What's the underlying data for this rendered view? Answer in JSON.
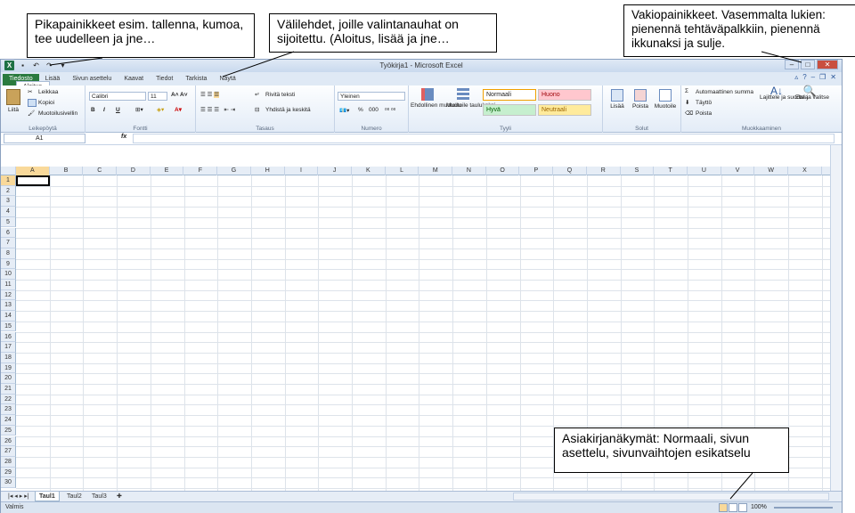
{
  "callouts": {
    "qat": "Pikapainikkeet esim. tallenna, kumoa, tee uudelleen ja jne…",
    "tabs": "Välilehdet, joille valintanauhat on sijoitettu. (Aloitus, lisää ja jne…",
    "window_buttons": "Vakiopainikkeet. Vasemmalta lukien: pienennä tehtäväpalkkiin, pienennä ikkunaksi ja sulje.",
    "views": "Asiakirjanäkymät: Normaali, sivun asettelu, sivunvaihtojen esikatselu"
  },
  "window": {
    "title": "Työkirja1 - Microsoft Excel"
  },
  "tabs": [
    "Tiedosto",
    "Aloitus",
    "Lisää",
    "Sivun asettelu",
    "Kaavat",
    "Tiedot",
    "Tarkista",
    "Näytä"
  ],
  "ribbon": {
    "clipboard": {
      "paste": "Liitä",
      "cut": "Leikkaa",
      "copy": "Kopioi",
      "format_painter": "Muotoilusivellin",
      "label": "Leikepöytä"
    },
    "font": {
      "name": "Calibri",
      "size": "11",
      "bold": "B",
      "italic": "I",
      "underline": "U",
      "label": "Fontti"
    },
    "alignment": {
      "wrap": "Rivitä teksti",
      "merge": "Yhdistä ja keskitä",
      "label": "Tasaus"
    },
    "number": {
      "format": "Yleinen",
      "percent": "%",
      "thousands": "000",
      "label": "Numero"
    },
    "styles": {
      "conditional": "Ehdollinen muotoilu",
      "table": "Muotoile taulukoksi",
      "normal": "Normaali",
      "bad": "Huono",
      "good": "Hyvä",
      "neutral": "Neutraali",
      "label": "Tyyli"
    },
    "cells": {
      "insert": "Lisää",
      "delete": "Poista",
      "format": "Muotoile",
      "label": "Solut"
    },
    "editing": {
      "autosum": "Automaattinen summa",
      "fill": "Täyttö",
      "clear": "Poista",
      "sort": "Lajittele ja suodata",
      "find": "Etsi ja valitse",
      "label": "Muokkaaminen"
    }
  },
  "formula_bar": {
    "name_box": "A1",
    "fx": "fx"
  },
  "columns": [
    "A",
    "B",
    "C",
    "D",
    "E",
    "F",
    "G",
    "H",
    "I",
    "J",
    "K",
    "L",
    "M",
    "N",
    "O",
    "P",
    "Q",
    "R",
    "S",
    "T",
    "U",
    "V",
    "W",
    "X"
  ],
  "rows": [
    "1",
    "2",
    "3",
    "4",
    "5",
    "6",
    "7",
    "8",
    "9",
    "10",
    "11",
    "12",
    "13",
    "14",
    "15",
    "16",
    "17",
    "18",
    "19",
    "20",
    "21",
    "22",
    "23",
    "24",
    "25",
    "26",
    "27",
    "28",
    "29",
    "30"
  ],
  "sheets": [
    "Taul1",
    "Taul2",
    "Taul3"
  ],
  "status": {
    "ready": "Valmis",
    "zoom": "100%"
  },
  "colors": {
    "file_tab": "#2a7a3f",
    "selection": "#f9d99a",
    "normal_style": "#ffffff",
    "bad_style": "#ffc7ce",
    "good_style": "#c6efce",
    "neutral_style": "#ffeb9c"
  }
}
